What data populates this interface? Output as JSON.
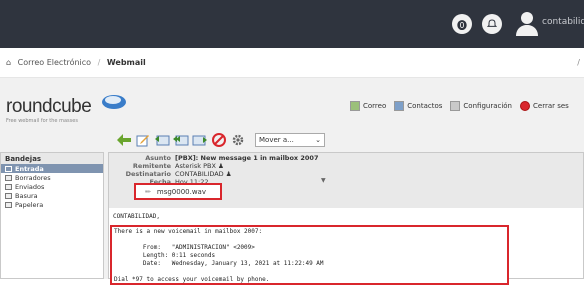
{
  "topbar": {
    "user": "contabilida",
    "btn1_glyph": "⓿",
    "btn2_glyph": "♢"
  },
  "breadcrumb": {
    "home": "Correo Electrónico",
    "current": "Webmail",
    "right": "/"
  },
  "logo": {
    "name": "roundcube",
    "tagline": "Free webmail for the masses"
  },
  "taskbar": {
    "mail": "Correo",
    "contacts": "Contactos",
    "settings": "Configuración",
    "logout": "Cerrar ses"
  },
  "toolbar": {
    "move": "Mover a..."
  },
  "sidebar": {
    "title": "Bandejas",
    "items": [
      {
        "label": "Entrada"
      },
      {
        "label": "Borradores"
      },
      {
        "label": "Enviados"
      },
      {
        "label": "Basura"
      },
      {
        "label": "Papelera"
      }
    ]
  },
  "message": {
    "subject_label": "Asunto",
    "subject": "[PBX]: New message 1 in mailbox 2007",
    "from_label": "Remitente",
    "from": "Asterisk PBX",
    "to_label": "Destinatario",
    "to": "CONTABILIDAD",
    "date_label": "Fecha",
    "date": "Hoy 11:22",
    "attachment": "msg0000.wav",
    "greeting": "CONTABILIDAD,",
    "body": "There is a new voicemail in mailbox 2007:\n\n        From:   \"ADMINISTRACION\" <2009>\n        Length: 0:11 seconds\n        Date:   Wednesday, January 13, 2021 at 11:22:49 AM\n\nDial *97 to access your voicemail by phone."
  },
  "colors": {
    "topbar": "#2f343e",
    "highlight": "#d9262c",
    "selected_folder": "#7f94b0"
  }
}
